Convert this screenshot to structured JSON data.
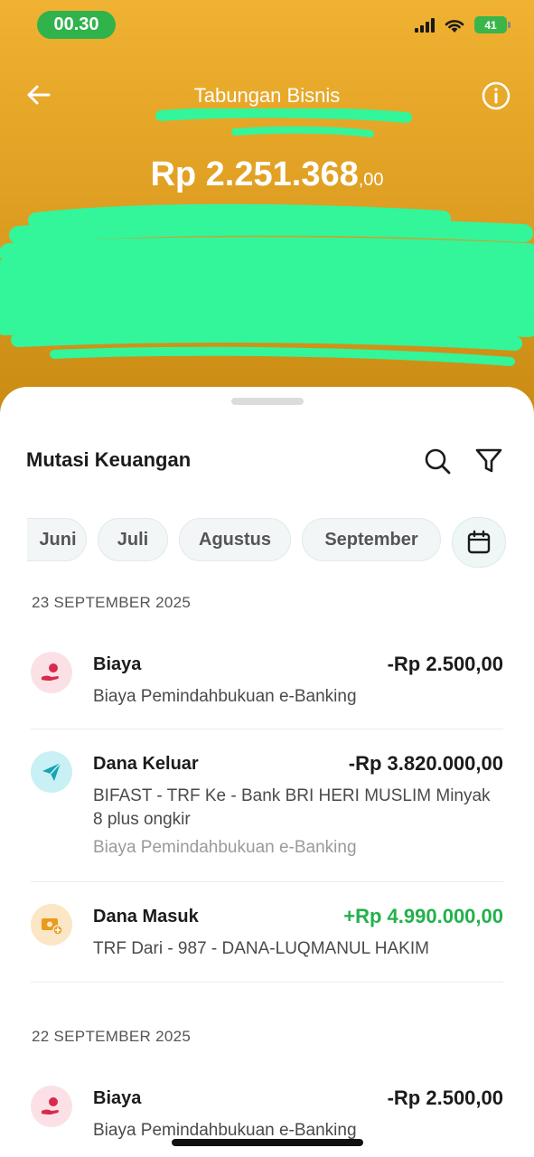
{
  "status_bar": {
    "time": "00.30",
    "battery": "41"
  },
  "header": {
    "title": "Tabungan Bisnis",
    "balance_main": "Rp 2.251.368",
    "balance_cents": ",00"
  },
  "section": {
    "title": "Mutasi Keuangan"
  },
  "months": [
    "Juni",
    "Juli",
    "Agustus",
    "September"
  ],
  "groups": [
    {
      "date": "23 SEPTEMBER 2025",
      "transactions": [
        {
          "title": "Biaya",
          "amount": "-Rp 2.500,00",
          "desc": "Biaya Pemindahbukuan e-Banking"
        },
        {
          "title": "Dana Keluar",
          "amount": "-Rp 3.820.000,00",
          "desc": "BIFAST - TRF Ke - Bank BRI HERI MUSLIM Minyak 8 plus ongkir",
          "sub": "Biaya Pemindahbukuan e-Banking"
        },
        {
          "title": "Dana Masuk",
          "amount": "+Rp 4.990.000,00",
          "desc": "TRF Dari - 987 - DANA-LUQMANUL HAKIM"
        }
      ]
    },
    {
      "date": "22 SEPTEMBER 2025",
      "transactions": [
        {
          "title": "Biaya",
          "amount": "-Rp 2.500,00",
          "desc": "Biaya Pemindahbukuan e-Banking"
        }
      ]
    }
  ],
  "colors": {
    "header": "#e0a023",
    "positive": "#22b14c",
    "fee_icon_bg": "#fbe1e6",
    "out_icon_bg": "#c9f0f4",
    "in_icon_bg": "#fbe6c6"
  }
}
